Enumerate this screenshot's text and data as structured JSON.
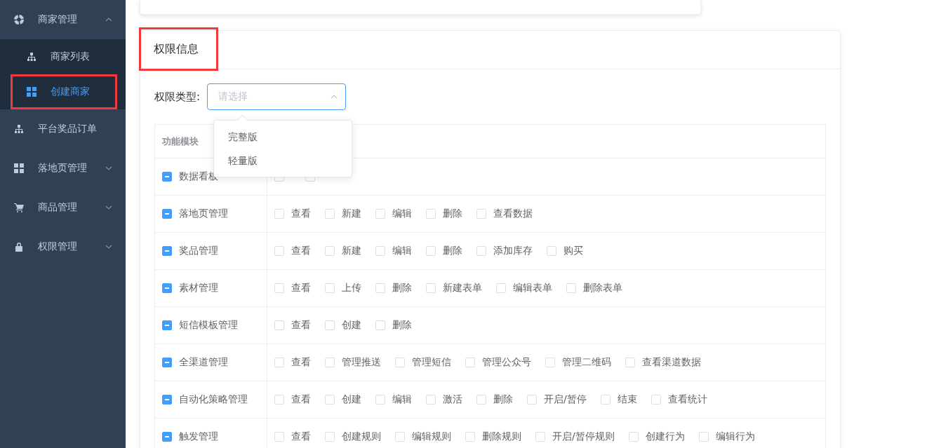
{
  "sidebar": {
    "items": [
      {
        "label": "商家管理",
        "has_children": true,
        "expanded": true,
        "children": [
          {
            "label": "商家列表",
            "selected": false,
            "highlighted": false
          },
          {
            "label": "创建商家",
            "selected": true,
            "highlighted": true
          }
        ]
      },
      {
        "label": "平台奖品订单",
        "has_children": false,
        "expanded": false
      },
      {
        "label": "落地页管理",
        "has_children": true,
        "expanded": false
      },
      {
        "label": "商品管理",
        "has_children": true,
        "expanded": false
      },
      {
        "label": "权限管理",
        "has_children": true,
        "expanded": false
      }
    ]
  },
  "card": {
    "title": "权限信息",
    "title_highlighted": true
  },
  "form": {
    "label": "权限类型:",
    "select": {
      "placeholder": "请选择",
      "open": true,
      "options": [
        "完整版",
        "轻量版"
      ]
    }
  },
  "table": {
    "header": "功能模块",
    "rows": [
      {
        "module": "数据看板",
        "indeterminate": true,
        "permissions": [
          {
            "checked": false
          },
          {
            "checked": false
          }
        ]
      },
      {
        "module": "落地页管理",
        "indeterminate": true,
        "permissions": [
          {
            "label": "查看",
            "checked": false
          },
          {
            "label": "新建",
            "checked": false
          },
          {
            "label": "编辑",
            "checked": false
          },
          {
            "label": "删除",
            "checked": false
          },
          {
            "label": "查看数据",
            "checked": false
          }
        ]
      },
      {
        "module": "奖品管理",
        "indeterminate": true,
        "permissions": [
          {
            "label": "查看",
            "checked": false
          },
          {
            "label": "新建",
            "checked": false
          },
          {
            "label": "编辑",
            "checked": false
          },
          {
            "label": "删除",
            "checked": false
          },
          {
            "label": "添加库存",
            "checked": false
          },
          {
            "label": "购买",
            "checked": false
          }
        ]
      },
      {
        "module": "素材管理",
        "indeterminate": true,
        "permissions": [
          {
            "label": "查看",
            "checked": false
          },
          {
            "label": "上传",
            "checked": false
          },
          {
            "label": "删除",
            "checked": false
          },
          {
            "label": "新建表单",
            "checked": false
          },
          {
            "label": "编辑表单",
            "checked": false
          },
          {
            "label": "删除表单",
            "checked": false
          }
        ]
      },
      {
        "module": "短信模板管理",
        "indeterminate": true,
        "permissions": [
          {
            "label": "查看",
            "checked": false
          },
          {
            "label": "创建",
            "checked": false
          },
          {
            "label": "删除",
            "checked": false
          }
        ]
      },
      {
        "module": "全渠道管理",
        "indeterminate": true,
        "permissions": [
          {
            "label": "查看",
            "checked": false
          },
          {
            "label": "管理推送",
            "checked": false
          },
          {
            "label": "管理短信",
            "checked": false
          },
          {
            "label": "管理公众号",
            "checked": false
          },
          {
            "label": "管理二维码",
            "checked": false
          },
          {
            "label": "查看渠道数据",
            "checked": false
          }
        ]
      },
      {
        "module": "自动化策略管理",
        "indeterminate": true,
        "permissions": [
          {
            "label": "查看",
            "checked": false
          },
          {
            "label": "创建",
            "checked": false
          },
          {
            "label": "编辑",
            "checked": false
          },
          {
            "label": "激活",
            "checked": false
          },
          {
            "label": "删除",
            "checked": false
          },
          {
            "label": "开启/暂停",
            "checked": false
          },
          {
            "label": "结束",
            "checked": false
          },
          {
            "label": "查看统计",
            "checked": false
          }
        ]
      },
      {
        "module": "触发管理",
        "indeterminate": true,
        "permissions": [
          {
            "label": "查看",
            "checked": false
          },
          {
            "label": "创建规则",
            "checked": false
          },
          {
            "label": "编辑规则",
            "checked": false
          },
          {
            "label": "删除规则",
            "checked": false
          },
          {
            "label": "开启/暂停规则",
            "checked": false
          },
          {
            "label": "创建行为",
            "checked": false
          },
          {
            "label": "编辑行为",
            "checked": false
          }
        ]
      }
    ]
  }
}
